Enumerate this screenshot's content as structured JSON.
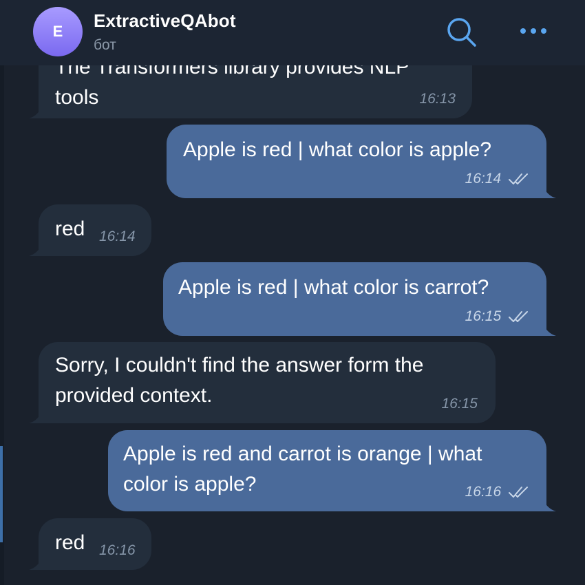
{
  "chat": {
    "avatar_letter": "E",
    "title": "ExtractiveQAbot",
    "subtitle": "бот",
    "search_icon": "search-icon",
    "more_icon": "more-icon"
  },
  "messages": [
    {
      "direction": "incoming",
      "text": "The Transformers library provides NLP\ntools",
      "time": "16:13"
    },
    {
      "direction": "outgoing",
      "text": "Apple is red | what color is apple?",
      "time": "16:14",
      "status": "read"
    },
    {
      "direction": "incoming",
      "text": "red",
      "time": "16:14"
    },
    {
      "direction": "outgoing",
      "text": "Apple is red | what color is carrot?",
      "time": "16:15",
      "status": "read"
    },
    {
      "direction": "incoming",
      "text": "Sorry, I couldn't find the answer form the\nprovided context.",
      "time": "16:15"
    },
    {
      "direction": "outgoing",
      "text": "Apple is red and carrot is orange | what\ncolor is apple?",
      "time": "16:16",
      "status": "read"
    },
    {
      "direction": "incoming",
      "text": "red",
      "time": "16:16"
    }
  ],
  "colors": {
    "background": "#1a212c",
    "incoming_bubble": "#232e3c",
    "outgoing_bubble": "#4a6a9a",
    "accent": "#5aa6f0"
  }
}
